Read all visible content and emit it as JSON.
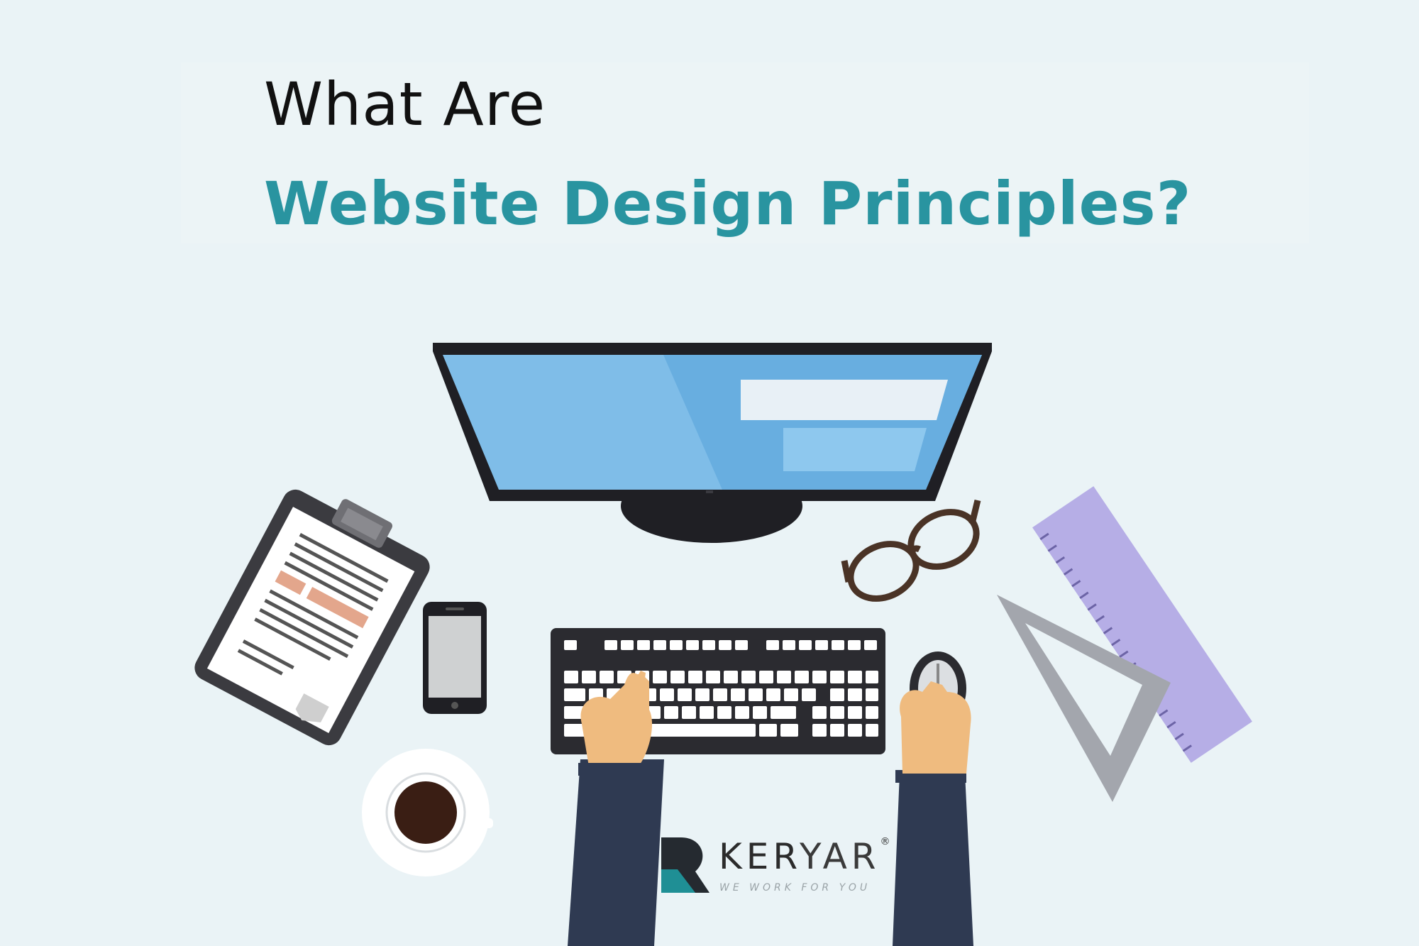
{
  "headline": {
    "line1": "What Are",
    "line2": "Website Design Principles?"
  },
  "brand": {
    "name_bold": "KER",
    "name_light": "YAR",
    "trademark": "®",
    "tagline": "WE WORK FOR YOU"
  },
  "colors": {
    "background": "#eaf3f6",
    "accent": "#2994a0",
    "monitor_screen": "#7fbde8"
  }
}
